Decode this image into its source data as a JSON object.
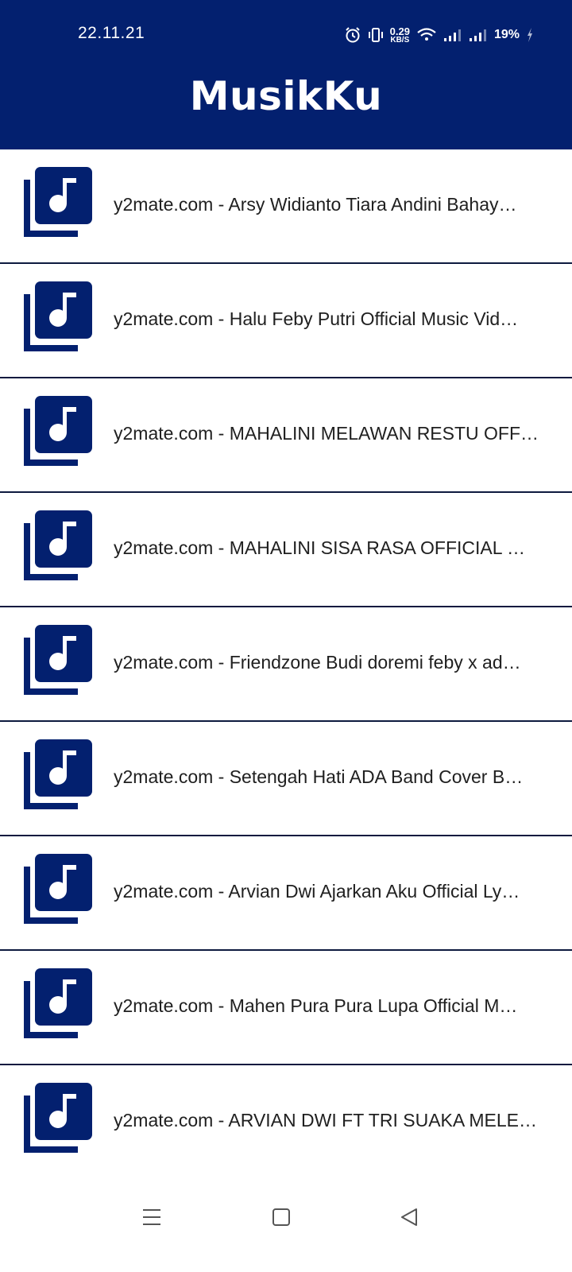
{
  "status_bar": {
    "time": "22.11.21",
    "net_speed_value": "0.29",
    "net_speed_unit": "KB/S",
    "battery_percent": "19%",
    "icons": [
      "alarm-icon",
      "vibrate-icon",
      "wifi-icon",
      "signal-icon",
      "signal-icon",
      "charging-icon"
    ]
  },
  "header": {
    "title": "MusikKu",
    "background_color": "#03206f"
  },
  "songs": [
    {
      "title": "y2mate.com - Arsy Widianto Tiara Andini  Bahay…",
      "icon": "music-library-icon"
    },
    {
      "title": "y2mate.com - Halu  Feby Putri Official Music Vid…",
      "icon": "music-library-icon"
    },
    {
      "title": "y2mate.com - MAHALINI  MELAWAN RESTU OFF…",
      "icon": "music-library-icon"
    },
    {
      "title": "y2mate.com - MAHALINI  SISA RASA OFFICIAL …",
      "icon": "music-library-icon"
    },
    {
      "title": "y2mate.com - Friendzone  Budi doremi feby x ad…",
      "icon": "music-library-icon"
    },
    {
      "title": "y2mate.com - Setengah Hati  ADA Band Cover B…",
      "icon": "music-library-icon"
    },
    {
      "title": "y2mate.com - Arvian Dwi  Ajarkan Aku Official Ly…",
      "icon": "music-library-icon"
    },
    {
      "title": "y2mate.com - Mahen  Pura Pura Lupa Official M…",
      "icon": "music-library-icon"
    },
    {
      "title": "y2mate.com - ARVIAN DWI FT TRI SUAKA  MELE…",
      "icon": "music-library-icon"
    }
  ],
  "nav_bar": {
    "buttons": [
      "menu-icon",
      "home-icon",
      "back-icon"
    ]
  }
}
